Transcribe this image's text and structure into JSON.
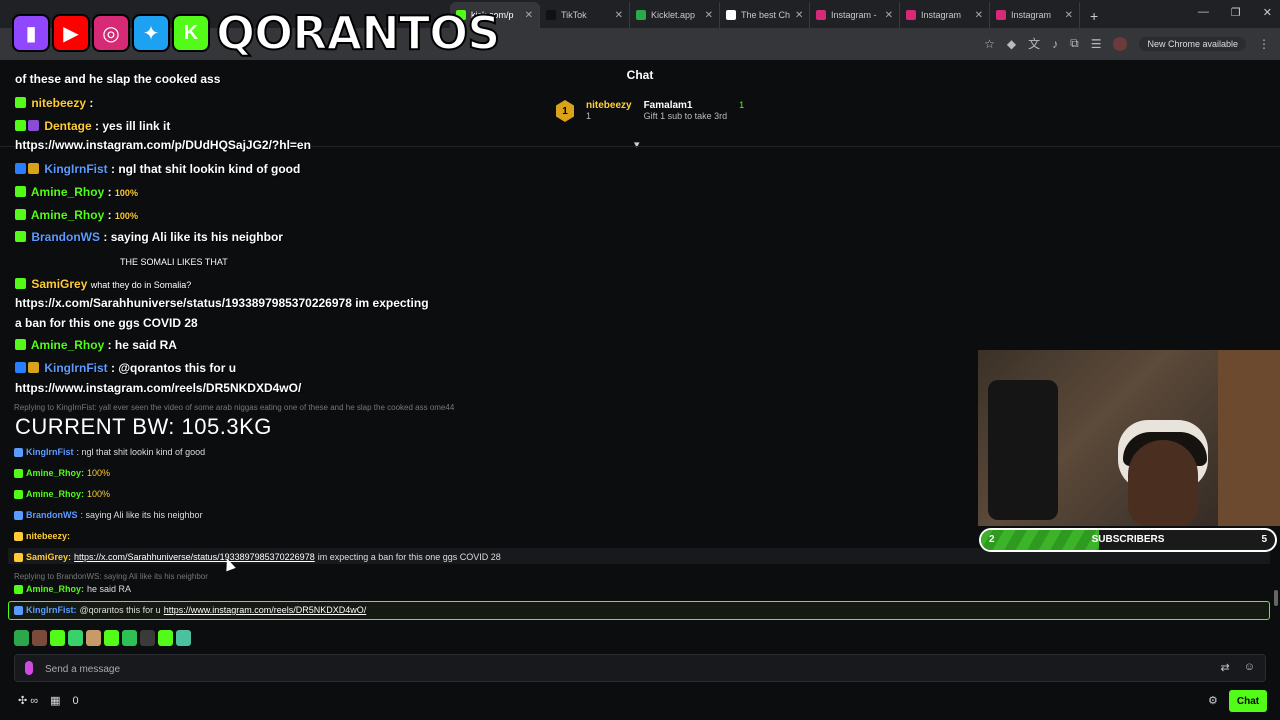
{
  "browser": {
    "tabs": [
      {
        "label": "kick.com/p",
        "active": true,
        "color": "#53fc18"
      },
      {
        "label": "TikTok",
        "active": false,
        "color": "#111111"
      },
      {
        "label": "Kicklet.app",
        "active": false,
        "color": "#2aa84a"
      },
      {
        "label": "The best Ch",
        "active": false,
        "color": "#ffffff"
      },
      {
        "label": "Instagram -",
        "active": false,
        "color": "#d62976"
      },
      {
        "label": "Instagram",
        "active": false,
        "color": "#d62976"
      },
      {
        "label": "Instagram",
        "active": false,
        "color": "#d62976"
      }
    ],
    "new_chrome_label": "New Chrome available"
  },
  "banner": {
    "brand": "QORANTOS",
    "socials": [
      {
        "icon": "twitch-icon",
        "color": "#9146ff",
        "glyph": "▮"
      },
      {
        "icon": "youtube-icon",
        "color": "#ff0000",
        "glyph": "▶"
      },
      {
        "icon": "instagram-icon",
        "color": "#d62976",
        "glyph": "◎"
      },
      {
        "icon": "twitter-icon",
        "color": "#1da1f2",
        "glyph": "✦"
      },
      {
        "icon": "kick-icon",
        "color": "#53fc18",
        "glyph": "K"
      }
    ]
  },
  "chat_header": {
    "title": "Chat",
    "leader_rank": "1",
    "leader_name": "nitebeezy",
    "leader_count": "1",
    "second_name": "Famalam1",
    "second_count": "1",
    "gift_prompt": "Gift 1 sub to take 3rd"
  },
  "overlay": {
    "line1_text": "of these and he slap the cooked ass",
    "line2_user": "nitebeezy",
    "line3_user": "Dentage",
    "line3_text": ": yes ill link it",
    "line4_link": "https://www.instagram.com/p/DUdHQSajJG2/?hl=en",
    "line5_user": "KingIrnFist",
    "line5_text": ": ngl that shit lookin kind of good",
    "line6_user": "Amine_Rhoy",
    "line6_text": "100%",
    "line7_user": "Amine_Rhoy",
    "line7_text": "100%",
    "line8_user": "BrandonWS",
    "line8_text": ": saying Ali like its his neighbor",
    "line9_text": "THE SOMALI LIKES THAT",
    "line10_user": "SamiGrey",
    "line10_text": "what they do in Somalia?",
    "line11_link": "https://x.com/Sarahhuniverse/status/1933897985370226978 im expecting",
    "line12_text": "a ban for this one ggs COVID 28",
    "line13_user": "Amine_Rhoy",
    "line13_text": ": he said RA",
    "line14_user": "KingIrnFist",
    "line14_text": ": @qorantos this for u",
    "line15_link": "https://www.instagram.com/reels/DR5NKDXD4wO/",
    "bw_label": "CURRENT BW: 105.3KG"
  },
  "native_chat": [
    {
      "type": "reply",
      "text": "Replying to KingIrnFist: yall ever seen the video of some arab niggas eating one of these and he slap the cooked ass ome44"
    },
    {
      "type": "msg",
      "user": "KingIrnFist",
      "color": "#5b9bff",
      "text": ": ngl that shit lookin kind of good",
      "link": ""
    },
    {
      "type": "msg",
      "user": "Amine_Rhoy:",
      "color": "#53fc18",
      "text": "100%",
      "link": ""
    },
    {
      "type": "msg",
      "user": "Amine_Rhoy:",
      "color": "#53fc18",
      "text": "100%",
      "link": ""
    },
    {
      "type": "msg",
      "user": "BrandonWS",
      "color": "#5b9bff",
      "text": ": saying Ali like its his neighbor",
      "link": ""
    },
    {
      "type": "msg",
      "user": "nitebeezy:",
      "color": "#ffcc33",
      "text": "",
      "link": ""
    },
    {
      "type": "msg",
      "user": "SamiGrey:",
      "color": "#ffcc33",
      "text": " im expecting a ban for this one ggs COVID 28",
      "link": "https://x.com/Sarahhuniverse/status/1933897985370226978"
    },
    {
      "type": "reply",
      "text": "Replying to BrandonWS: saying Ali like its his neighbor"
    },
    {
      "type": "msg",
      "user": "Amine_Rhoy:",
      "color": "#53fc18",
      "text": " he said RA",
      "link": ""
    },
    {
      "type": "msg",
      "user": "KingIrnFist:",
      "color": "#5b9bff",
      "text": " @qorantos this for u ",
      "link": "https://www.instagram.com/reels/DR5NKDXD4wO/"
    }
  ],
  "sub_goal": {
    "current": "2",
    "label": "SUBSCRIBERS",
    "goal": "5",
    "progress": 0.4
  },
  "composer": {
    "placeholder": "Send a message",
    "points": "0",
    "send_label": "Chat"
  }
}
